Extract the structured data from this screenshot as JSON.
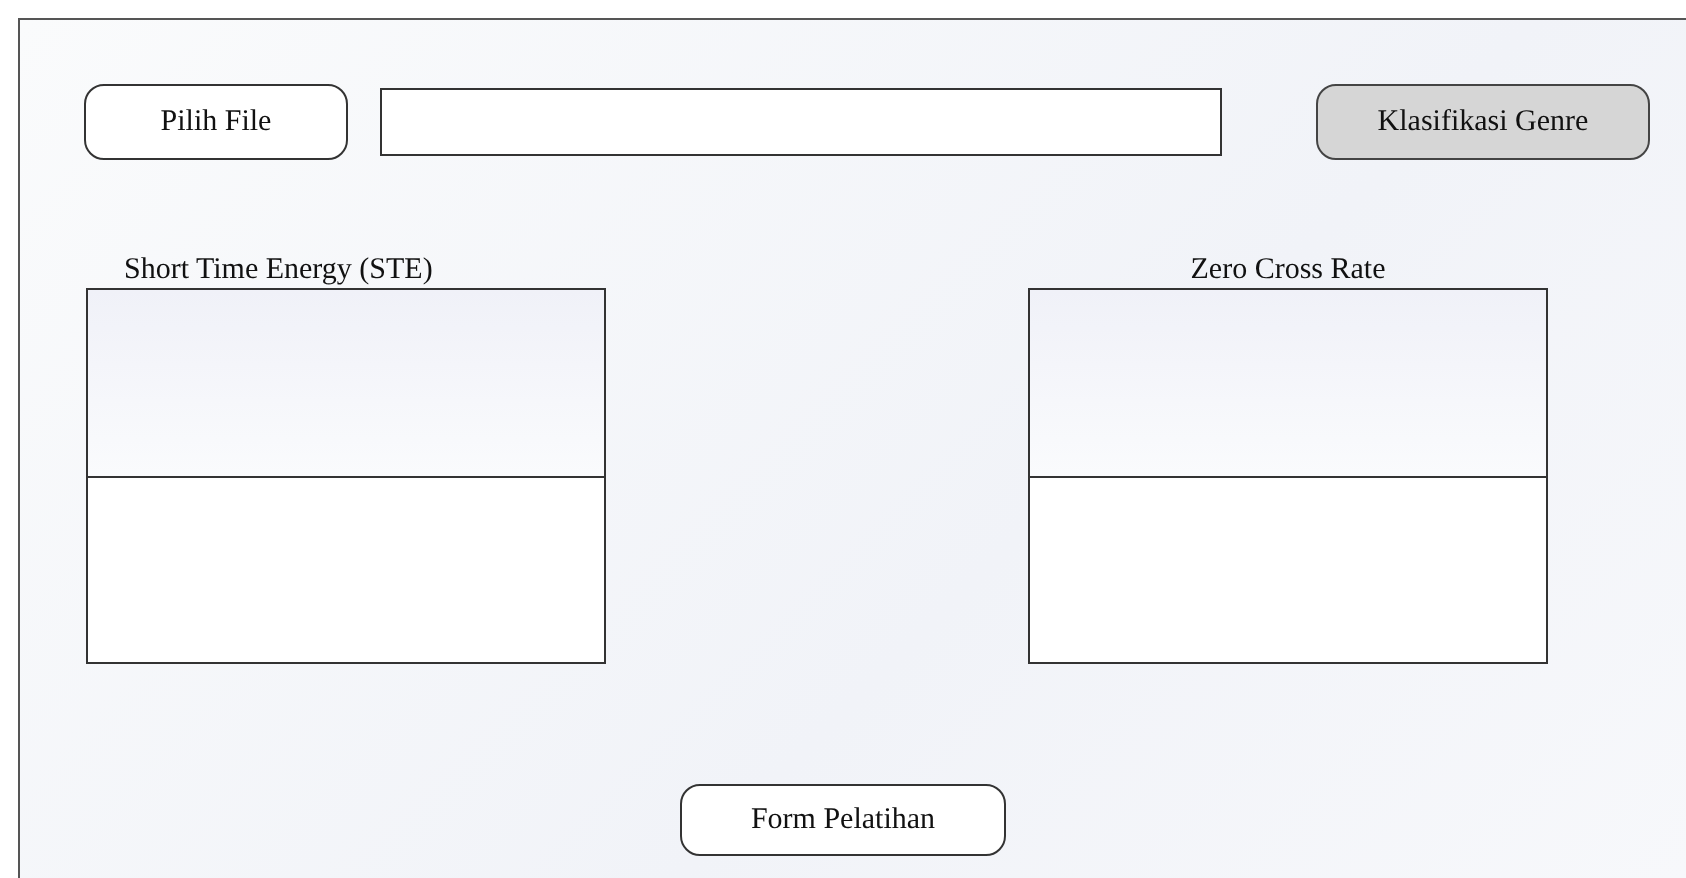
{
  "top_bar": {
    "file_button": "Pilih File",
    "classify_button": "Klasifikasi Genre"
  },
  "panels": [
    {
      "title": "Short Time Energy (STE)"
    },
    {
      "title": "Zero Cross Rate"
    }
  ],
  "bottom_button": "Form Pelatihan"
}
